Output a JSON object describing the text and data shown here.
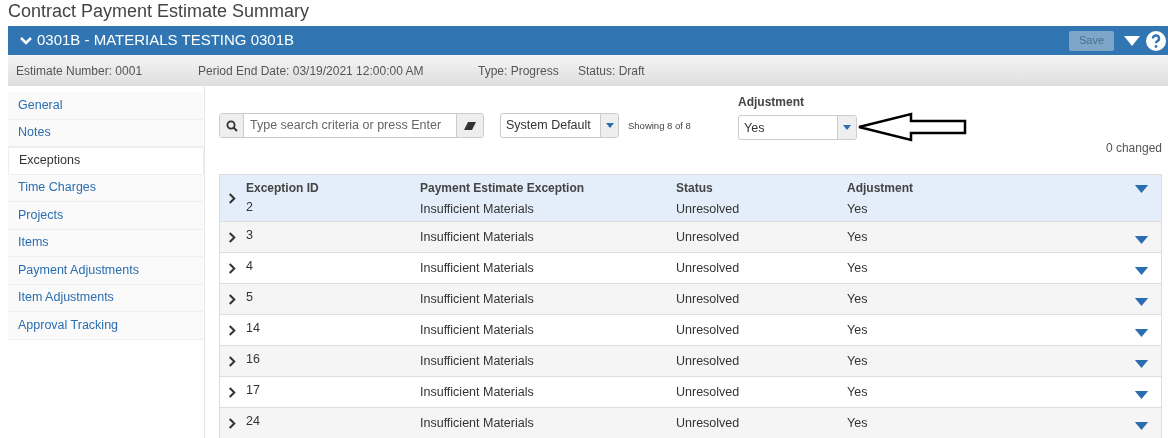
{
  "page_title": "Contract Payment Estimate Summary",
  "header": {
    "title": "0301B - MATERIALS TESTING 0301B",
    "save_button": {
      "label": "Save",
      "disabled": true
    }
  },
  "info_bar": [
    "Estimate Number: 0001",
    "Period End Date: 03/19/2021 12:00:00 AM",
    "Type: Progress",
    "Status: Draft"
  ],
  "sidebar": {
    "items": [
      {
        "label": "General",
        "selected": false
      },
      {
        "label": "Notes",
        "selected": false
      },
      {
        "label": "Exceptions",
        "selected": true
      },
      {
        "label": "Time Charges",
        "selected": false
      },
      {
        "label": "Projects",
        "selected": false
      },
      {
        "label": "Items",
        "selected": false
      },
      {
        "label": "Payment Adjustments",
        "selected": false
      },
      {
        "label": "Item Adjustments",
        "selected": false
      },
      {
        "label": "Approval Tracking",
        "selected": false
      }
    ]
  },
  "toolbar": {
    "search": {
      "placeholder": "Type search criteria or press Enter"
    },
    "view": "System Default",
    "showing": "Showing 8 of 8",
    "filter": {
      "label": "Adjustment",
      "value": "Yes"
    },
    "changed": "0 changed"
  },
  "table": {
    "columns": [
      "Exception ID",
      "Payment Estimate Exception",
      "Status",
      "Adjustment"
    ],
    "rows": [
      {
        "cells": [
          "2",
          "Insufficient Materials",
          "Unresolved",
          "Yes"
        ],
        "selected": true
      },
      {
        "cells": [
          "3",
          "Insufficient Materials",
          "Unresolved",
          "Yes"
        ],
        "selected": false
      },
      {
        "cells": [
          "4",
          "Insufficient Materials",
          "Unresolved",
          "Yes"
        ],
        "selected": false
      },
      {
        "cells": [
          "5",
          "Insufficient Materials",
          "Unresolved",
          "Yes"
        ],
        "selected": false
      },
      {
        "cells": [
          "14",
          "Insufficient Materials",
          "Unresolved",
          "Yes"
        ],
        "selected": false
      },
      {
        "cells": [
          "16",
          "Insufficient Materials",
          "Unresolved",
          "Yes"
        ],
        "selected": false
      },
      {
        "cells": [
          "17",
          "Insufficient Materials",
          "Unresolved",
          "Yes"
        ],
        "selected": false
      },
      {
        "cells": [
          "24",
          "Insufficient Materials",
          "Unresolved",
          "Yes"
        ],
        "selected": false
      }
    ]
  }
}
